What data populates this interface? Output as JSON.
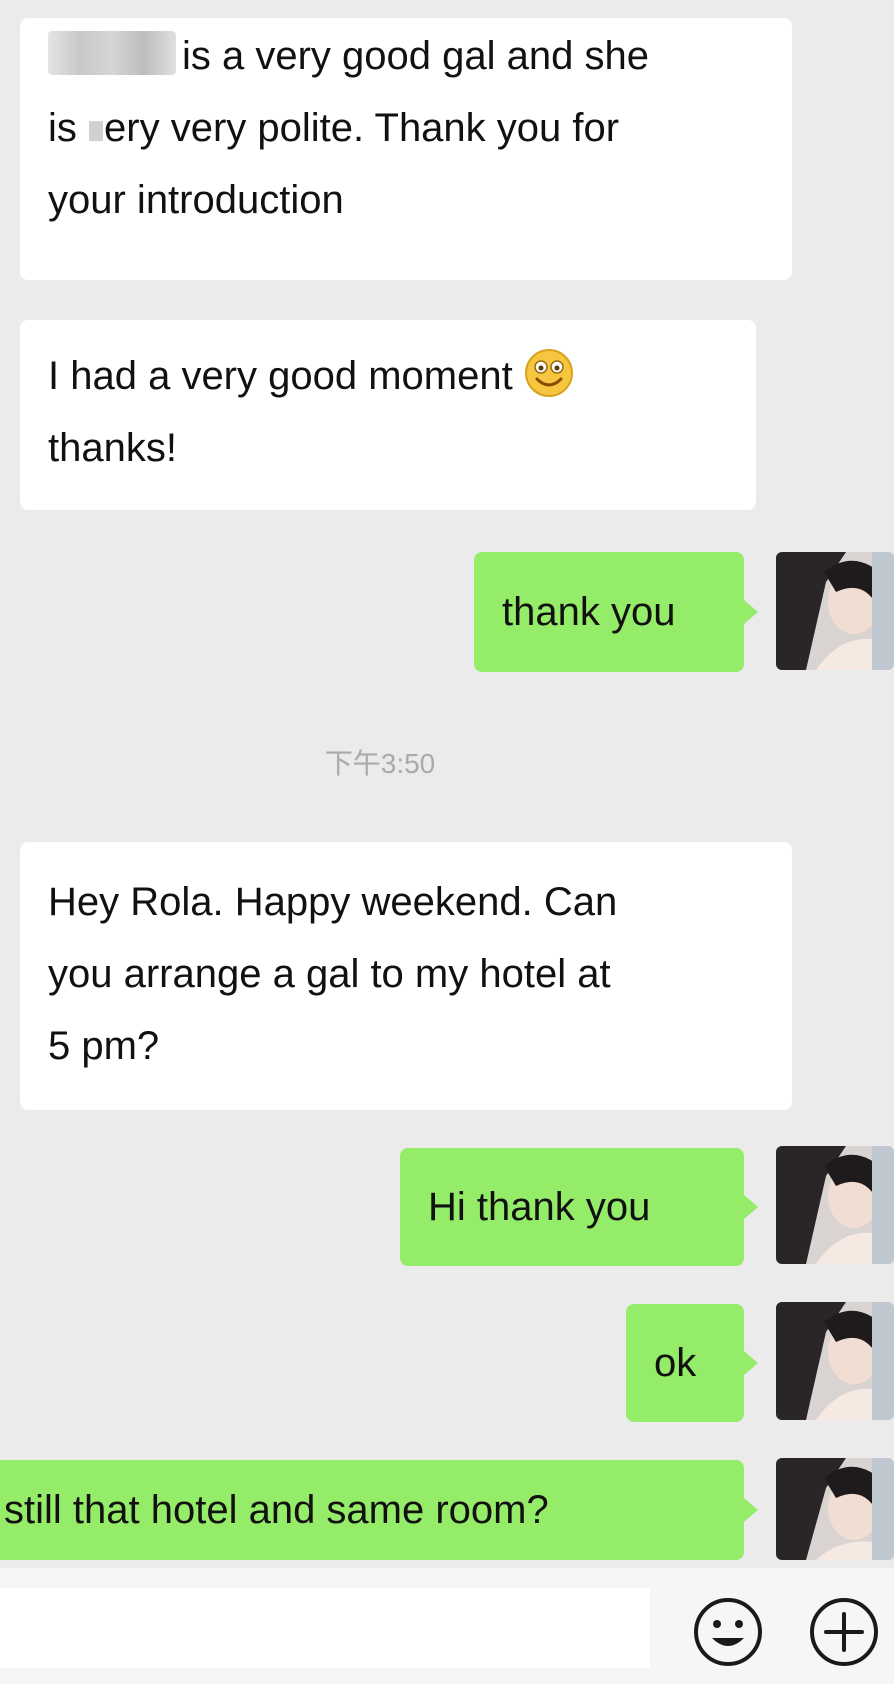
{
  "messages": [
    {
      "side": "in",
      "text_after_redaction": "is a very good gal and she",
      "line2_start": "is",
      "line2_rest": "ery very polite. Thank you for",
      "line3": "your introduction"
    },
    {
      "side": "in",
      "line1": "I had a very good moment",
      "line2": "thanks!",
      "emoji": "smiling-face-emoji"
    },
    {
      "side": "out",
      "text": "thank you"
    },
    {
      "side": "in",
      "line1": "Hey Rola. Happy weekend. Can",
      "line2": "you arrange a gal to my hotel at",
      "line3": "5 pm?"
    },
    {
      "side": "out",
      "text": "Hi thank you"
    },
    {
      "side": "out",
      "text": "ok"
    },
    {
      "side": "out",
      "text": "still that hotel and same room?"
    }
  ],
  "timestamp": "下午3:50",
  "icons": {
    "emoji_button": "smiley-icon",
    "more_button": "plus-icon"
  },
  "colors": {
    "background": "#ebebeb",
    "incoming_bubble": "#ffffff",
    "outgoing_bubble": "#95ec69",
    "timestamp_text": "#aaaaaa"
  }
}
